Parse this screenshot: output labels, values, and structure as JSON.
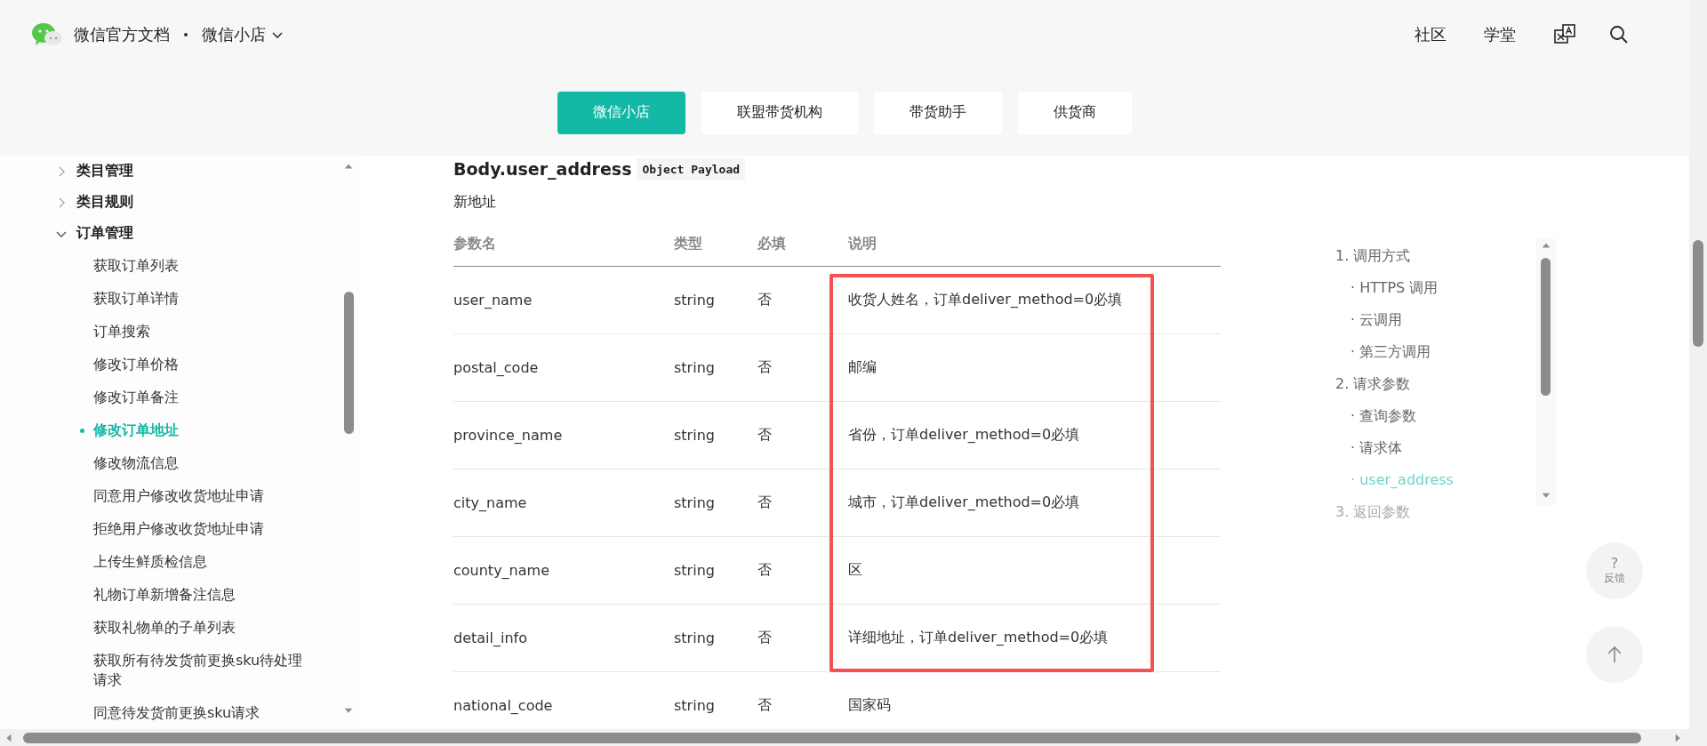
{
  "header": {
    "site_title": "微信官方文档",
    "section": "微信小店",
    "nav": [
      {
        "label": "社区"
      },
      {
        "label": "学堂"
      }
    ]
  },
  "subnav": [
    {
      "label": "微信小店",
      "selected": true
    },
    {
      "label": "联盟带货机构",
      "selected": false
    },
    {
      "label": "带货助手",
      "selected": false
    },
    {
      "label": "供货商",
      "selected": false
    }
  ],
  "sidebar": {
    "items": [
      {
        "label": "类目管理",
        "expanded": false
      },
      {
        "label": "类目规则",
        "expanded": false
      },
      {
        "label": "订单管理",
        "expanded": true,
        "children": [
          {
            "label": "获取订单列表",
            "selected": false
          },
          {
            "label": "获取订单详情",
            "selected": false
          },
          {
            "label": "订单搜索",
            "selected": false
          },
          {
            "label": "修改订单价格",
            "selected": false
          },
          {
            "label": "修改订单备注",
            "selected": false
          },
          {
            "label": "修改订单地址",
            "selected": true
          },
          {
            "label": "修改物流信息",
            "selected": false
          },
          {
            "label": "同意用户修改收货地址申请",
            "selected": false
          },
          {
            "label": "拒绝用户修改收货地址申请",
            "selected": false
          },
          {
            "label": "上传生鲜质检信息",
            "selected": false
          },
          {
            "label": "礼物订单新增备注信息",
            "selected": false
          },
          {
            "label": "获取礼物单的子单列表",
            "selected": false
          },
          {
            "label": "获取所有待发货前更换sku待处理请求",
            "selected": false
          },
          {
            "label": "同意待发货前更换sku请求",
            "selected": false
          }
        ]
      }
    ]
  },
  "content": {
    "heading": "Body.user_address",
    "badge": "Object Payload",
    "description": "新地址",
    "table": {
      "columns": [
        "参数名",
        "类型",
        "必填",
        "说明"
      ],
      "rows": [
        {
          "cells": [
            "user_name",
            "string",
            "否",
            "收货人姓名，订单deliver_method=0必填"
          ],
          "highlighted": true
        },
        {
          "cells": [
            "postal_code",
            "string",
            "否",
            "邮编"
          ],
          "highlighted": true
        },
        {
          "cells": [
            "province_name",
            "string",
            "否",
            "省份，订单deliver_method=0必填"
          ],
          "highlighted": true
        },
        {
          "cells": [
            "city_name",
            "string",
            "否",
            "城市，订单deliver_method=0必填"
          ],
          "highlighted": true
        },
        {
          "cells": [
            "county_name",
            "string",
            "否",
            "区"
          ],
          "highlighted": true
        },
        {
          "cells": [
            "detail_info",
            "string",
            "否",
            "详细地址，订单deliver_method=0必填"
          ],
          "highlighted": true
        },
        {
          "cells": [
            "national_code",
            "string",
            "否",
            "国家码"
          ],
          "highlighted": false
        }
      ]
    }
  },
  "toc": [
    {
      "label": "1. 调用方式",
      "selected": false,
      "faded": false,
      "children": [
        {
          "label": "· HTTPS 调用",
          "selected": false
        },
        {
          "label": "· 云调用",
          "selected": false
        },
        {
          "label": "· 第三方调用",
          "selected": false
        }
      ]
    },
    {
      "label": "2. 请求参数",
      "selected": false,
      "faded": false,
      "children": [
        {
          "label": "· 查询参数",
          "selected": false
        },
        {
          "label": "· 请求体",
          "selected": false
        },
        {
          "label": "· user_address",
          "selected": true
        }
      ]
    },
    {
      "label": "3. 返回参数",
      "selected": false,
      "faded": true
    }
  ],
  "feedback": {
    "mark": "?",
    "label": "反馈"
  }
}
